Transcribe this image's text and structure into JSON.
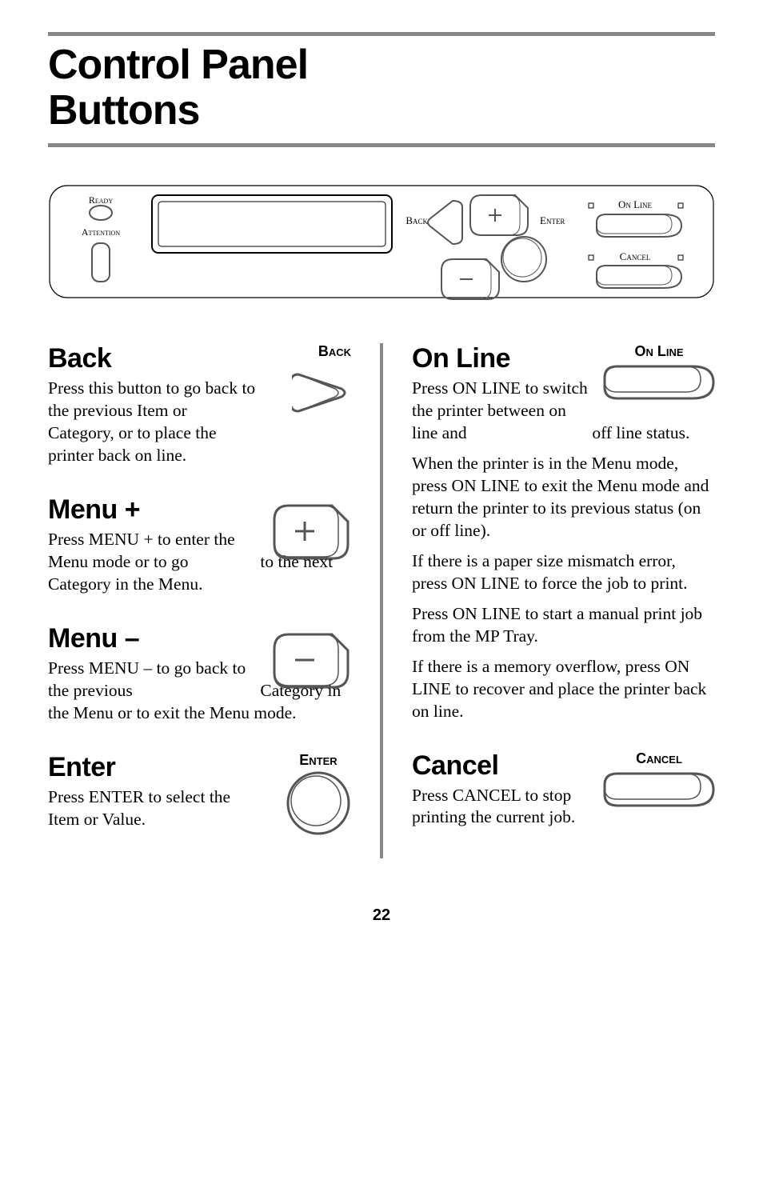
{
  "title_line1": "Control Panel",
  "title_line2": "Buttons",
  "panel": {
    "ready": "Ready",
    "attention": "Attention",
    "back": "Back",
    "enter": "Enter",
    "online": "On Line",
    "cancel": "Cancel"
  },
  "sections": {
    "back": {
      "heading": "Back",
      "label": "Back",
      "body": "Press this button to go back to the previous Item or Category, or to place the printer back on line."
    },
    "menuplus": {
      "heading": "Menu +",
      "body_wrap": "Press MENU + to enter the Menu mode or to go",
      "body_rest": "to the next Category in the Menu."
    },
    "menuminus": {
      "heading": "Menu –",
      "body_wrap": "Press MENU – to go back to the previous",
      "body_rest": "Category in the Menu or to exit the Menu mode."
    },
    "enter": {
      "heading": "Enter",
      "label": "Enter",
      "body": "Press ENTER to select the Item or Value."
    },
    "online": {
      "heading": "On Line",
      "label": "On Line",
      "body1_wrap": "Press ON LINE to switch the printer between on line and",
      "body1_rest": "off line status.",
      "body2": "When the printer is in the Menu mode, press ON LINE to exit the Menu mode and return the printer to its previous status (on or off line).",
      "body3": "If there is a paper size mismatch error, press ON LINE to force the job to print.",
      "body4": "Press ON LINE to start a manual print job from the MP Tray.",
      "body5": "If there is a memory overflow, press ON LINE to recover and place the printer back on line."
    },
    "cancel": {
      "heading": "Cancel",
      "label": "Cancel",
      "body": "Press CANCEL to stop printing the current job."
    }
  },
  "page_number": "22"
}
